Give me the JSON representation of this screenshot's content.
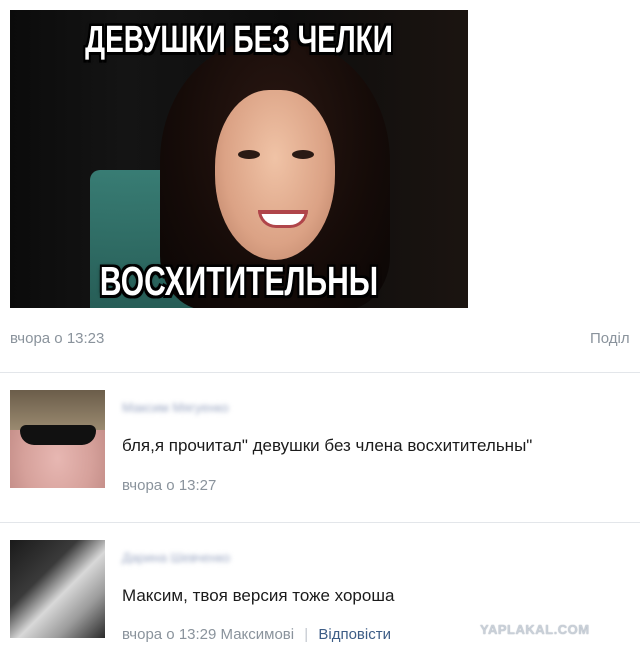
{
  "post": {
    "meme_top_text": "ДЕВУШКИ БЕЗ ЧЕЛКИ",
    "meme_bottom_text": "ВОСХИТИТЕЛЬНЫ",
    "time": "вчора о 13:23",
    "share_label": "Поділ"
  },
  "comments": [
    {
      "author": "Максим Мягуенко",
      "text": "бля,я прочитал\" девушки без члена восхитительны\"",
      "time": "вчора о 13:27"
    },
    {
      "author": "Дарина Шевченко",
      "text": "Максим, твоя версия тоже хороша",
      "time": "вчора о 13:29",
      "reply_to": "Максимові",
      "reply_label": "Відповісти"
    }
  ],
  "watermark": "YAPLAKAL.COM"
}
